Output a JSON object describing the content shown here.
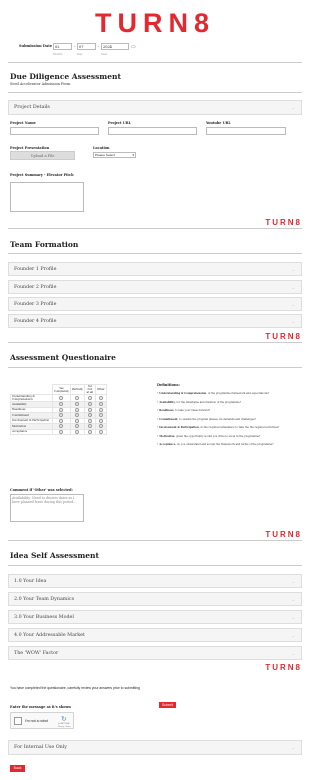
{
  "brand": {
    "logo": "TURN8",
    "accent": "#e3282f"
  },
  "submission_date": {
    "label": "Submission Date",
    "month": "02",
    "day": "07",
    "year": "2024",
    "month_sub": "Month",
    "day_sub": "Day",
    "year_sub": "Year"
  },
  "header": {
    "title": "Due Diligence Assessment",
    "subtitle": "Seed Accelerator Admission Form"
  },
  "project": {
    "details_label": "Project Details",
    "name_label": "Project Name",
    "url_label": "Project URL",
    "youtube_label": "Youtube URL",
    "presentation_label": "Project Presentation",
    "upload_label": "Upload a File",
    "location_label": "Location",
    "location_value": "Please Select",
    "summary_label": "Project Summary - Elevator Pitch"
  },
  "team": {
    "title": "Team Formation",
    "founders": [
      "Founder 1 Profile",
      "Founder 2 Profile",
      "Founder 3 Profile",
      "Founder 4 Profile"
    ]
  },
  "questionnaire": {
    "title": "Assessment Questionaire",
    "columns": [
      "Yes Completely",
      "Partially",
      "Yet Not at all",
      "Other"
    ],
    "rows": [
      "Understanding & Comprehension",
      "Availability",
      "Readiness",
      "Commitment",
      "Involvement & Participation",
      "Motivation",
      "Acceptance"
    ],
    "definitions_title": "Definitions:",
    "definitions": [
      {
        "term": "Understanding & Comprehension",
        "text": "of the programme framework and expectations?"
      },
      {
        "term": "Availability",
        "text": "for the timeframe and duration of the programme?"
      },
      {
        "term": "Readiness",
        "text": "to take your ideas forward?"
      },
      {
        "term": "Commitment",
        "text": "to sustain the program phases, its demands and challenges?"
      },
      {
        "term": "Involvement & Participation",
        "text": "in the required attendance to take the the required activities?"
      },
      {
        "term": "Motivation",
        "text": "given the opportunity would you drive to excel in the programme?"
      },
      {
        "term": "Acceptance",
        "text": "do you understand and accept the framework and terms of the programme?"
      }
    ],
    "comment_label": "Comment if 'Other' was selected:",
    "comment_placeholder": "Availability: Need to discuss dates as I have planned leave during this period..."
  },
  "idea": {
    "title": "Idea Self Assessment",
    "items": [
      "1.0 Your Idea",
      "2.0 Your Team Dynamics",
      "3.0 Your Business Model",
      "4.0 Your Addressable Market",
      "The 'WOW' Factor"
    ]
  },
  "footer": {
    "completed_text": "You have completed the questionaire, carefully review your answers prior to submitting",
    "submit_label": "Submit",
    "captcha_label": "Enter the message as it's shown",
    "recaptcha_text": "I'm not a robot",
    "recaptcha_brand": "reCAPTCHA",
    "recaptcha_terms": "Privacy - Terms",
    "internal_label": "For Internal Use Only",
    "back_label": "Back"
  }
}
